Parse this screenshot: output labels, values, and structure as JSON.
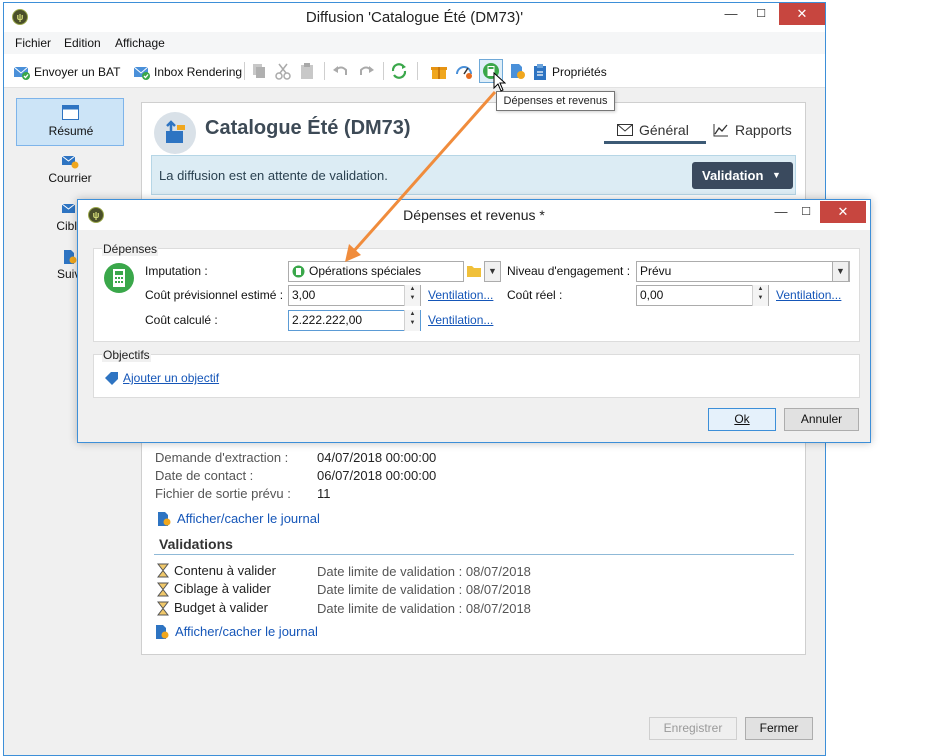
{
  "window": {
    "title": "Diffusion 'Catalogue Été (DM73)'"
  },
  "menu": {
    "items": [
      "Fichier",
      "Edition",
      "Affichage"
    ]
  },
  "toolbar": {
    "send_proof_label": "Envoyer un BAT",
    "inbox_rendering_label": "Inbox Rendering",
    "properties_label": "Propriétés",
    "tooltip": "Dépenses et revenus"
  },
  "nav": {
    "items": [
      {
        "label": "Résumé"
      },
      {
        "label": "Courrier"
      },
      {
        "label": "Cible"
      },
      {
        "label": "Suivi"
      }
    ]
  },
  "header": {
    "title": "Catalogue Été (DM73)",
    "tab_general": "Général",
    "tab_reports": "Rapports"
  },
  "banner": {
    "text": "La diffusion est en attente de validation.",
    "validation_button": "Validation"
  },
  "details": {
    "rows": [
      {
        "label": "Demande d'extraction :",
        "value": "04/07/2018 00:00:00"
      },
      {
        "label": "Date de contact :",
        "value": "06/07/2018 00:00:00"
      },
      {
        "label": "Fichier de sortie prévu :",
        "value": "11"
      }
    ],
    "toggle_log_1": "Afficher/cacher le journal"
  },
  "validations": {
    "title": "Validations",
    "items": [
      {
        "label": "Contenu à valider",
        "deadline": "Date limite de validation : 08/07/2018"
      },
      {
        "label": "Ciblage à valider",
        "deadline": "Date limite de validation : 08/07/2018"
      },
      {
        "label": "Budget à valider",
        "deadline": "Date limite de validation : 08/07/2018"
      }
    ],
    "toggle_log_2": "Afficher/cacher le journal"
  },
  "footer": {
    "save_button": "Enregistrer",
    "close_button": "Fermer"
  },
  "dialog": {
    "title": "Dépenses et revenus *",
    "expenses_legend": "Dépenses",
    "imputation_label": "Imputation :",
    "imputation_value": "Opérations spéciales",
    "engagement_label": "Niveau d'engagement :",
    "engagement_value": "Prévu",
    "estimated_cost_label": "Coût prévisionnel estimé :",
    "estimated_cost_value": "3,00",
    "real_cost_label": "Coût réel :",
    "real_cost_value": "0,00",
    "computed_cost_label": "Coût calculé :",
    "computed_cost_value": "2.222.222,00",
    "breakdown_link": "Ventilation...",
    "objectives_legend": "Objectifs",
    "add_objective_link": "Ajouter un objectif",
    "ok_button": "Ok",
    "cancel_button": "Annuler"
  },
  "colors": {
    "accent": "#3d8fd8",
    "annotation_arrow": "#f08c3c",
    "close_button": "#c7463f",
    "banner_bg": "#dcecf4",
    "validation_button": "#3a4a5e"
  }
}
